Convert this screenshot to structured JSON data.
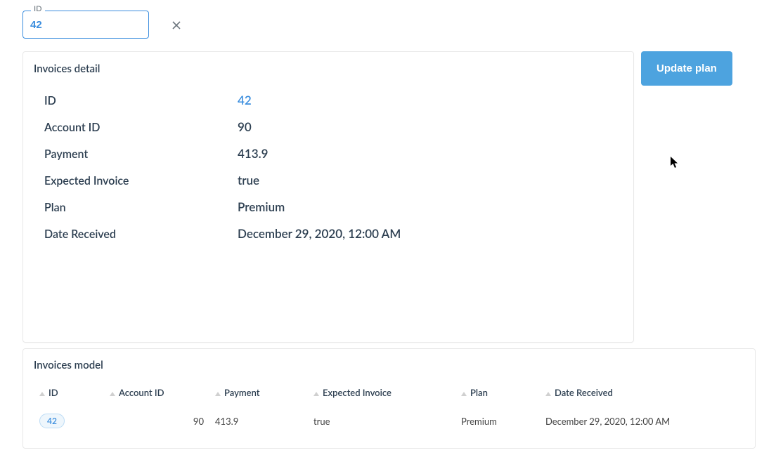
{
  "idFilter": {
    "label": "ID",
    "value": "42"
  },
  "detailCard": {
    "title": "Invoices detail",
    "rows": [
      {
        "label": "ID",
        "value": "42",
        "link": true
      },
      {
        "label": "Account ID",
        "value": "90",
        "link": false
      },
      {
        "label": "Payment",
        "value": "413.9",
        "link": false
      },
      {
        "label": "Expected Invoice",
        "value": "true",
        "link": false
      },
      {
        "label": "Plan",
        "value": "Premium",
        "link": false
      },
      {
        "label": "Date Received",
        "value": "December 29, 2020, 12:00 AM",
        "link": false
      }
    ]
  },
  "updateBtn": "Update plan",
  "modelCard": {
    "title": "Invoices model",
    "headers": {
      "id": "ID",
      "accountId": "Account ID",
      "payment": "Payment",
      "expected": "Expected Invoice",
      "plan": "Plan",
      "date": "Date Received"
    },
    "row": {
      "id": "42",
      "accountId": "90",
      "payment": "413.9",
      "expected": "true",
      "plan": "Premium",
      "date": "December 29, 2020, 12:00 AM"
    }
  }
}
